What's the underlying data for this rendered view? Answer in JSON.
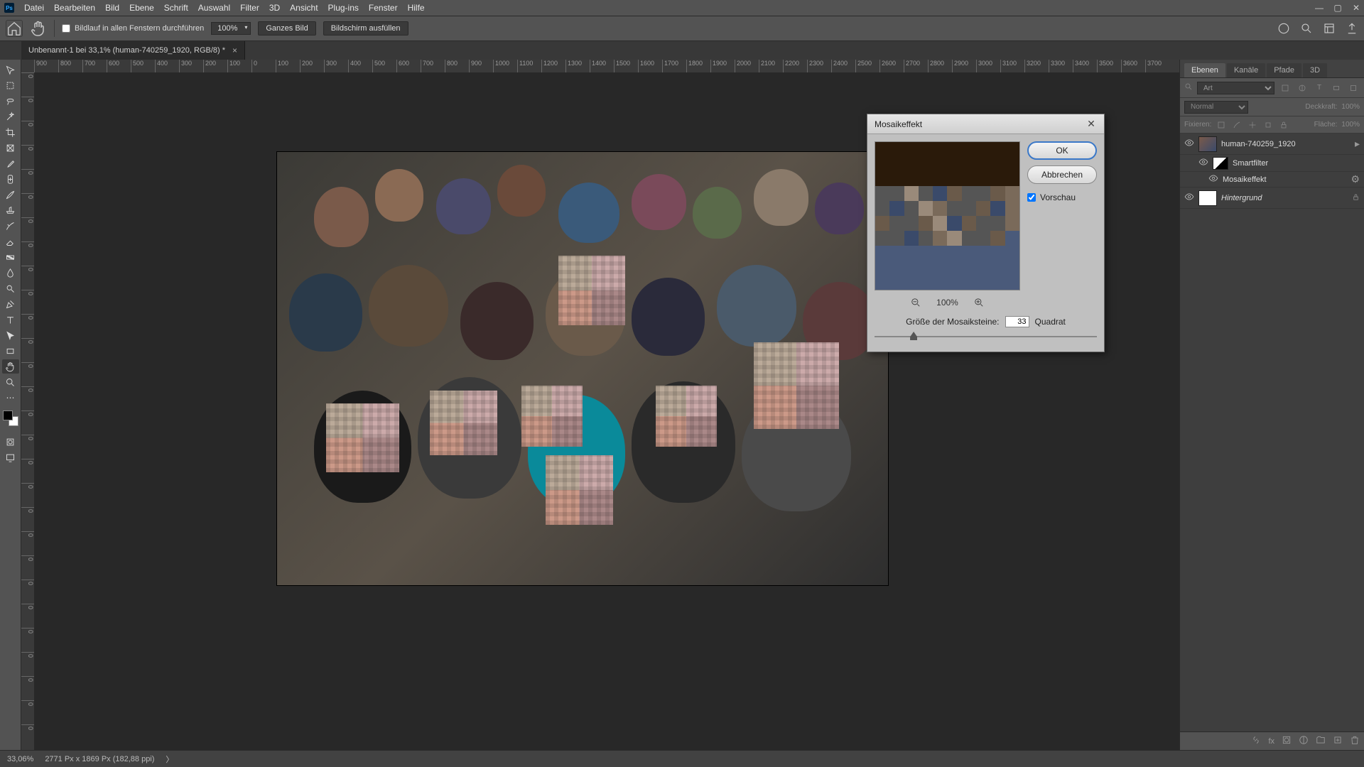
{
  "menubar": {
    "items": [
      "Datei",
      "Bearbeiten",
      "Bild",
      "Ebene",
      "Schrift",
      "Auswahl",
      "Filter",
      "3D",
      "Ansicht",
      "Plug-ins",
      "Fenster",
      "Hilfe"
    ]
  },
  "optionsbar": {
    "scroll_all_label": "Bildlauf in allen Fenstern durchführen",
    "zoom_value": "100%",
    "fit_label": "Ganzes Bild",
    "fill_label": "Bildschirm ausfüllen"
  },
  "doctab": {
    "title": "Unbenannt-1 bei 33,1% (human-740259_1920, RGB/8) *"
  },
  "ruler_h": [
    "900",
    "800",
    "700",
    "600",
    "500",
    "400",
    "300",
    "200",
    "100",
    "0",
    "100",
    "200",
    "300",
    "400",
    "500",
    "600",
    "700",
    "800",
    "900",
    "1000",
    "1100",
    "1200",
    "1300",
    "1400",
    "1500",
    "1600",
    "1700",
    "1800",
    "1900",
    "2000",
    "2100",
    "2200",
    "2300",
    "2400",
    "2500",
    "2600",
    "2700",
    "2800",
    "2900",
    "3000",
    "3100",
    "3200",
    "3300",
    "3400",
    "3500",
    "3600",
    "3700"
  ],
  "ruler_v": [
    "0",
    "0",
    "0",
    "0",
    "0",
    "0",
    "0",
    "0",
    "0",
    "0",
    "0",
    "0",
    "0",
    "0",
    "0",
    "0",
    "0",
    "0",
    "0",
    "0",
    "0",
    "0",
    "0",
    "0",
    "0",
    "0",
    "0",
    "0"
  ],
  "right_panel": {
    "tabs": [
      "Ebenen",
      "Kanäle",
      "Pfade",
      "3D"
    ],
    "filter_placeholder": "Art",
    "blend_mode": "Normal",
    "opacity_label": "Deckkraft:",
    "opacity_value": "100%",
    "lock_label": "Fixieren:",
    "fill_label": "Fläche:",
    "fill_value": "100%",
    "layers": [
      {
        "name": "human-740259_1920"
      },
      {
        "name": "Smartfilter"
      },
      {
        "name": "Mosaikeffekt"
      },
      {
        "name": "Hintergrund"
      }
    ]
  },
  "dialog": {
    "title": "Mosaikeffekt",
    "ok": "OK",
    "cancel": "Abbrechen",
    "preview_label": "Vorschau",
    "zoom": "100%",
    "param_label": "Größe der Mosaiksteine:",
    "param_value": "33",
    "param_unit": "Quadrat"
  },
  "statusbar": {
    "zoom": "33,06%",
    "docinfo": "2771 Px x 1869 Px (182,88 ppi)"
  }
}
